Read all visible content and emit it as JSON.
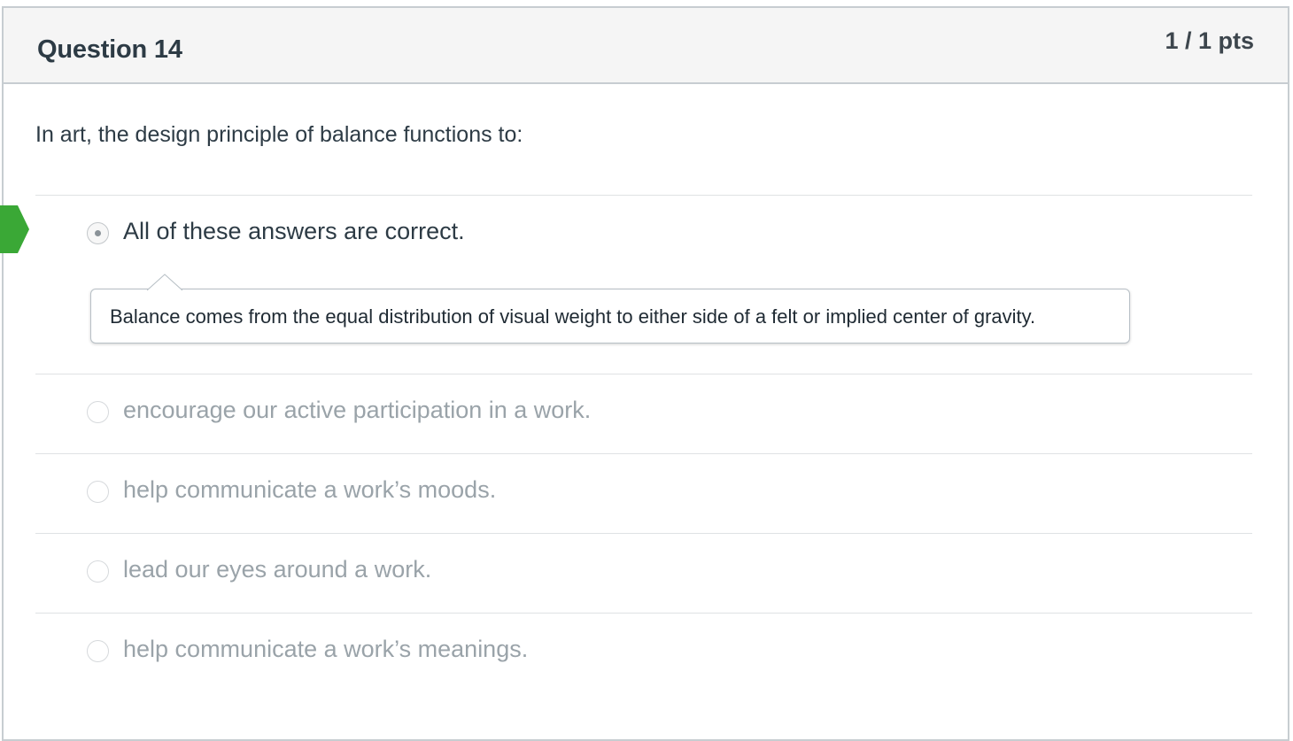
{
  "question": {
    "title": "Question 14",
    "points": "1 / 1 pts",
    "text": "In art, the design principle of balance functions to:"
  },
  "answers": [
    {
      "label": "All of these answers are correct.",
      "selected": true,
      "correct": true
    },
    {
      "label": "encourage our active participation in a work.",
      "selected": false
    },
    {
      "label": "help communicate a work’s moods.",
      "selected": false
    },
    {
      "label": "lead our eyes around a work.",
      "selected": false
    },
    {
      "label": "help communicate a work’s meanings.",
      "selected": false
    }
  ],
  "comment": {
    "text": "Balance comes from the equal distribution of visual weight to either side of a felt or implied center of gravity."
  },
  "colors": {
    "correct_flag": "#3aa836",
    "muted_text": "#9aa3a9",
    "header_bg": "#f5f5f5",
    "border": "#c7cdd1"
  }
}
